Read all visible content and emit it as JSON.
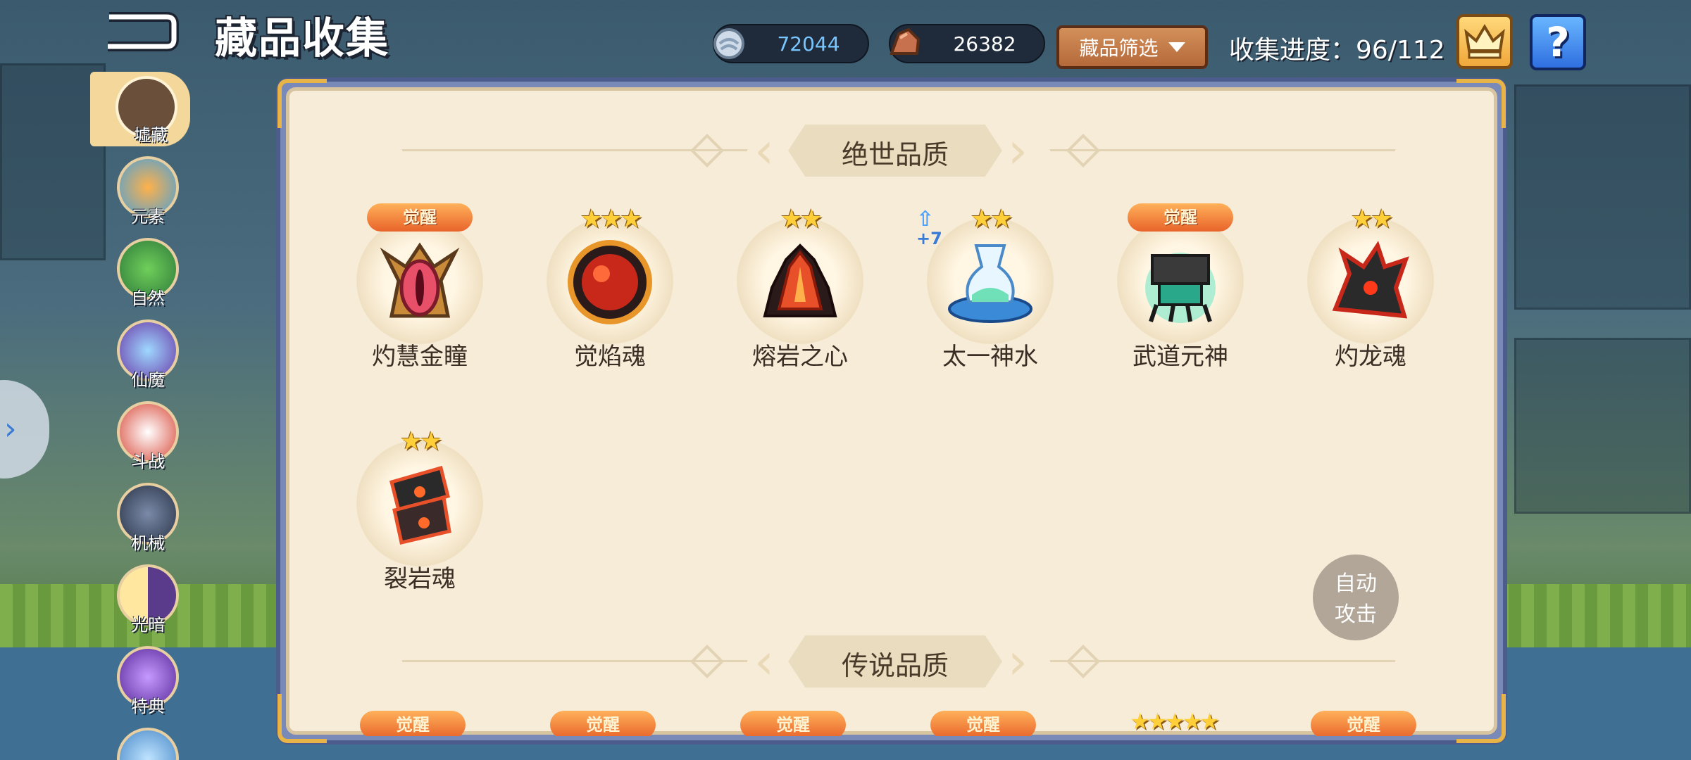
{
  "header": {
    "title": "藏品收集",
    "currency1": "72044",
    "currency2": "26382",
    "filter_label": "藏品筛选",
    "progress": "收集进度：96/112",
    "help_label": "?"
  },
  "sidebar": {
    "items": [
      {
        "label": "墟藏",
        "active": true
      },
      {
        "label": "元素"
      },
      {
        "label": "自然"
      },
      {
        "label": "仙魔"
      },
      {
        "label": "斗战"
      },
      {
        "label": "机械"
      },
      {
        "label": "光暗"
      },
      {
        "label": "特典"
      }
    ],
    "expand_glyph": "›"
  },
  "sections": [
    {
      "title": "绝世品质",
      "items": [
        {
          "name": "灼慧金瞳",
          "badge": "觉醒"
        },
        {
          "name": "觉焰魂",
          "stars": "★★★"
        },
        {
          "name": "熔岩之心",
          "stars": "★★"
        },
        {
          "name": "太一神水",
          "stars": "★★",
          "boost": "+7"
        },
        {
          "name": "武道元神",
          "badge": "觉醒"
        },
        {
          "name": "灼龙魂",
          "stars": "★★"
        },
        {
          "name": "裂岩魂",
          "stars": "★★"
        }
      ]
    },
    {
      "title": "传说品质",
      "items": [
        {
          "badge": "觉醒"
        },
        {
          "badge": "觉醒"
        },
        {
          "badge": "觉醒"
        },
        {
          "badge": "觉醒"
        },
        {
          "stars": "★★★★★"
        },
        {
          "badge": "觉醒"
        }
      ]
    }
  ],
  "auto_attack": {
    "line1": "自动",
    "line2": "攻击"
  },
  "icons": {
    "back": "back-arrow-icon",
    "currency1": "spirit-stone-icon",
    "currency2": "ore-icon",
    "crown": "crown-icon",
    "help": "help-icon"
  }
}
